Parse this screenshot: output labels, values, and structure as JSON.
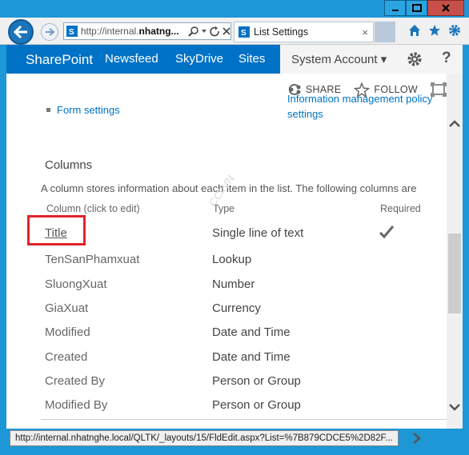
{
  "browser": {
    "address_url_prefix": "http://internal.",
    "address_url_bold": "nhatng...",
    "tab_title": "List Settings",
    "tab_close": "×",
    "caption": {
      "minimize_icon": "minimize-icon",
      "maximize_icon": "maximize-icon",
      "close_icon": "close-icon"
    }
  },
  "suitebar": {
    "brand": "SharePoint",
    "links": [
      "Newsfeed",
      "SkyDrive",
      "Sites"
    ],
    "account": "System Account ▾",
    "help": "?"
  },
  "actions": {
    "share": "SHARE",
    "follow": "FOLLOW"
  },
  "settings_links": {
    "form_settings": "Form settings",
    "imp_line1": "Information management policy",
    "imp_line2": "settings"
  },
  "columns": {
    "title": "Columns",
    "description": "A column stores information about each item in the list. The following columns are",
    "headers": [
      "Column (click to edit)",
      "Type",
      "Required"
    ],
    "rows": [
      {
        "name": "Title",
        "type": "Single line of text",
        "required": true
      },
      {
        "name": "TenSanPhamxuat",
        "type": "Lookup",
        "required": false
      },
      {
        "name": "SluongXuat",
        "type": "Number",
        "required": false
      },
      {
        "name": "GiaXuat",
        "type": "Currency",
        "required": false
      },
      {
        "name": "Modified",
        "type": "Date and Time",
        "required": false
      },
      {
        "name": "Created",
        "type": "Date and Time",
        "required": false
      },
      {
        "name": "Created By",
        "type": "Person or Group",
        "required": false
      },
      {
        "name": "Modified By",
        "type": "Person or Group",
        "required": false
      }
    ]
  },
  "watermark": "CCI.VN",
  "status_url": "http://internal.nhatnghe.local/QLTK/_layouts/15/FldEdit.aspx?List=%7B879CDCE5%2D82F...",
  "colors": {
    "accent": "#0072c6",
    "highlight": "#e3232b",
    "frame": "#1e97d6"
  }
}
